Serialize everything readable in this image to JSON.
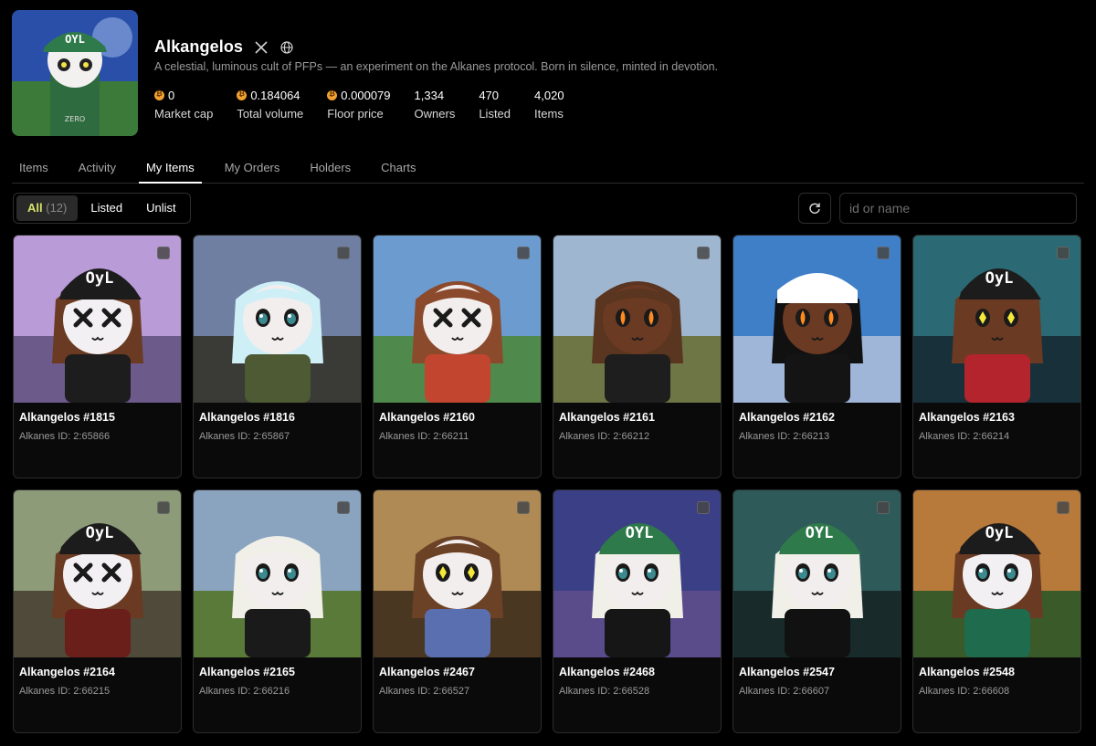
{
  "collection": {
    "name": "Alkangelos",
    "description": "A celestial, luminous cult of PFPs — an experiment on the Alkanes protocol. Born in silence, minted in devotion.",
    "social_icons": [
      "x-icon",
      "globe-icon"
    ]
  },
  "stats": [
    {
      "value": "0",
      "label": "Market cap",
      "btc": true
    },
    {
      "value": "0.184064",
      "label": "Total volume",
      "btc": true
    },
    {
      "value": "0.000079",
      "label": "Floor price",
      "btc": true
    },
    {
      "value": "1,334",
      "label": "Owners",
      "btc": false
    },
    {
      "value": "470",
      "label": "Listed",
      "btc": false
    },
    {
      "value": "4,020",
      "label": "Items",
      "btc": false
    }
  ],
  "tabs": [
    {
      "label": "Items",
      "active": false
    },
    {
      "label": "Activity",
      "active": false
    },
    {
      "label": "My Items",
      "active": true
    },
    {
      "label": "My Orders",
      "active": false
    },
    {
      "label": "Holders",
      "active": false
    },
    {
      "label": "Charts",
      "active": false
    }
  ],
  "filters": {
    "all_label": "All",
    "all_count": "(12)",
    "listed_label": "Listed",
    "unlist_label": "Unlist"
  },
  "search": {
    "placeholder": "id or name"
  },
  "colors": {
    "accent": "#d8e36a",
    "btc": "#f1a032"
  },
  "items": [
    {
      "name": "Alkangelos #1815",
      "id": "Alkanes ID: 2:65866",
      "bg": "#b99bd8",
      "bg2": "#6c5a8a",
      "hair": "#6b3a22",
      "skin": "#f2f0f2",
      "hat": "#1c1c1c",
      "hatText": "OyL",
      "eyes": "x",
      "outfit": "#1d1d1d"
    },
    {
      "name": "Alkangelos #1816",
      "id": "Alkanes ID: 2:65867",
      "bg": "#6f7fa1",
      "bg2": "#3a3a36",
      "hair": "#cfeff7",
      "skin": "#f3eeee",
      "hat": "",
      "hatText": "",
      "eyes": "g",
      "outfit": "#4d5a34"
    },
    {
      "name": "Alkangelos #2160",
      "id": "Alkanes ID: 2:66211",
      "bg": "#6c9bd0",
      "bg2": "#4f8a4c",
      "hair": "#8b4a2c",
      "skin": "#f3eeee",
      "hat": "",
      "hatText": "",
      "eyes": "x",
      "outfit": "#c2462f"
    },
    {
      "name": "Alkangelos #2161",
      "id": "Alkanes ID: 2:66212",
      "bg": "#9fb6d1",
      "bg2": "#6e7646",
      "hair": "#5a3520",
      "skin": "#6b3a22",
      "hat": "",
      "hatText": "",
      "eyes": "f",
      "outfit": "#1e1e1e"
    },
    {
      "name": "Alkangelos #2162",
      "id": "Alkanes ID: 2:66213",
      "bg": "#3e7fc8",
      "bg2": "#9fb6d8",
      "hair": "#111111",
      "skin": "#6b3a22",
      "hat": "#ffffff",
      "hatText": "",
      "eyes": "f",
      "outfit": "#141414"
    },
    {
      "name": "Alkangelos #2163",
      "id": "Alkanes ID: 2:66214",
      "bg": "#2b6a74",
      "bg2": "#17303a",
      "hair": "#6b3a22",
      "skin": "#6b3a22",
      "hat": "#1c1c1c",
      "hatText": "OyL",
      "eyes": "y",
      "outfit": "#b3242c"
    },
    {
      "name": "Alkangelos #2164",
      "id": "Alkanes ID: 2:66215",
      "bg": "#8d9b78",
      "bg2": "#4f4a3a",
      "hair": "#6b3a22",
      "skin": "#f2f0f2",
      "hat": "#1c1c1c",
      "hatText": "OyL",
      "eyes": "x",
      "outfit": "#6b1f1a"
    },
    {
      "name": "Alkangelos #2165",
      "id": "Alkanes ID: 2:66216",
      "bg": "#8aa4c0",
      "bg2": "#5a7a3a",
      "hair": "#f0efe8",
      "skin": "#f2eeee",
      "hat": "",
      "hatText": "",
      "eyes": "g",
      "outfit": "#1a1a1a"
    },
    {
      "name": "Alkangelos #2467",
      "id": "Alkanes ID: 2:66527",
      "bg": "#b08a55",
      "bg2": "#4a3722",
      "hair": "#6b4226",
      "skin": "#f3eeee",
      "hat": "",
      "hatText": "",
      "eyes": "y",
      "outfit": "#5a6fb0"
    },
    {
      "name": "Alkangelos #2468",
      "id": "Alkanes ID: 2:66528",
      "bg": "#3a3f86",
      "bg2": "#5a4b8a",
      "hair": "#f0efe8",
      "skin": "#f3eeee",
      "hat": "#2e7a4a",
      "hatText": "OYL",
      "eyes": "g",
      "outfit": "#161616"
    },
    {
      "name": "Alkangelos #2547",
      "id": "Alkanes ID: 2:66607",
      "bg": "#2f5a5a",
      "bg2": "#182a2a",
      "hair": "#f0efe8",
      "skin": "#f3eeee",
      "hat": "#2e7a4a",
      "hatText": "OYL",
      "eyes": "g",
      "outfit": "#111111"
    },
    {
      "name": "Alkangelos #2548",
      "id": "Alkanes ID: 2:66608",
      "bg": "#b87a3a",
      "bg2": "#3a5a2a",
      "hair": "#6b3a22",
      "skin": "#f2f0f2",
      "hat": "#1c1c1c",
      "hatText": "OyL",
      "eyes": "g",
      "outfit": "#1f6b4e"
    }
  ]
}
